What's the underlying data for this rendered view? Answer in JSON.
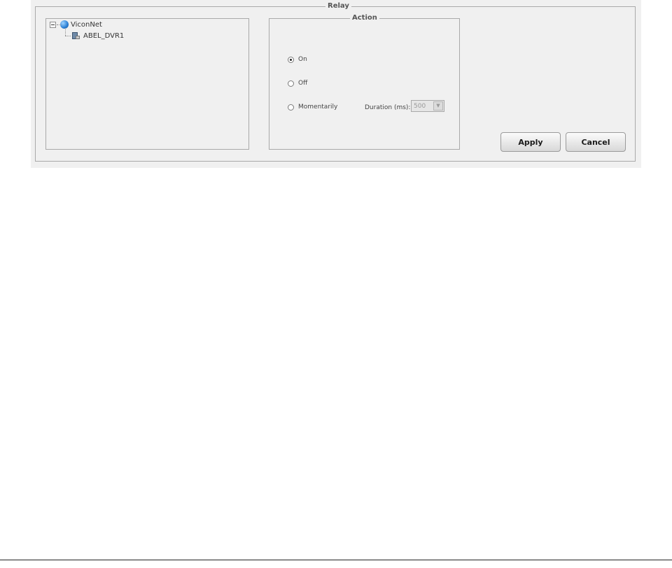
{
  "relay": {
    "title": "Relay",
    "tree": {
      "root_label": "ViconNet",
      "child_label": "ABEL_DVR1"
    },
    "action": {
      "title": "Action",
      "options": [
        {
          "label": "On",
          "checked": true
        },
        {
          "label": "Off",
          "checked": false
        },
        {
          "label": "Momentarily",
          "checked": false
        }
      ],
      "duration_label": "Duration (ms):",
      "duration_value": "500"
    },
    "buttons": {
      "apply_label": "Apply",
      "cancel_label": "Cancel"
    }
  },
  "icons": {
    "expander": "tree-collapse-icon",
    "root": "globe-network-icon",
    "child": "dvr-device-icon",
    "dropdown": "chevron-down-icon"
  },
  "colors": {
    "panel_bg": "#f0f0f0",
    "frame_border": "#a9a9a9",
    "legend_text": "#555555"
  }
}
